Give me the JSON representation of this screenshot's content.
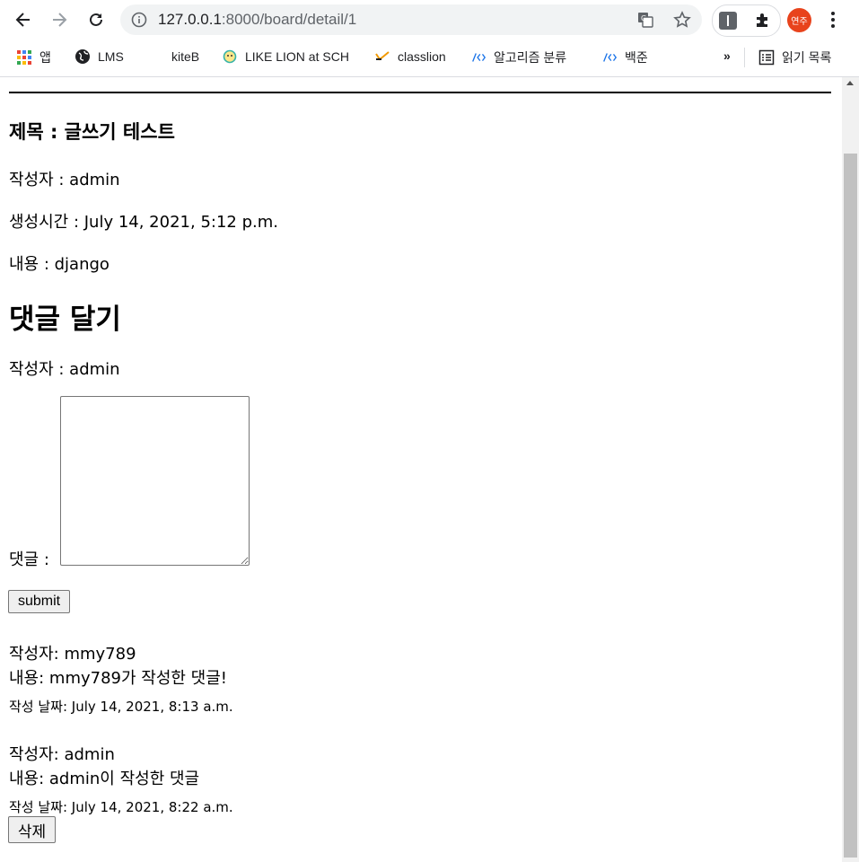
{
  "browser": {
    "url_host": "127.0.0.1",
    "url_rest": ":8000/board/detail/1",
    "profile_initials": "연주",
    "bookmarks": [
      {
        "label": "앱",
        "icon": "apps-grid-icon"
      },
      {
        "label": "LMS",
        "icon": "globe-icon"
      },
      {
        "label": "kiteB",
        "icon": "blank-icon"
      },
      {
        "label": "LIKE LION at SCH",
        "icon": "lion-icon"
      },
      {
        "label": "classlion",
        "icon": "classlion-icon"
      },
      {
        "label": "알고리즘 분류",
        "icon": "code-icon"
      },
      {
        "label": "백준",
        "icon": "code-icon"
      }
    ],
    "more_label": "»",
    "reading_list_label": "읽기 목록"
  },
  "post": {
    "title": "제목 : 글쓰기 테스트",
    "author": "작성자 : admin",
    "created": "생성시간 : July 14, 2021, 5:12 p.m.",
    "content": "내용 : django"
  },
  "comment_form": {
    "heading": "댓글 달기",
    "author": "작성자 : admin",
    "comment_label": "댓글 :",
    "submit_label": "submit"
  },
  "comments": [
    {
      "author": "작성자: mmy789",
      "content": "내용: mmy789가 작성한 댓글!",
      "date": "작성 날짜: July 14, 2021, 8:13 a.m."
    },
    {
      "author": "작성자: admin",
      "content": "내용: admin이 작성한 댓글",
      "date": "작성 날짜: July 14, 2021, 8:22 a.m.",
      "delete_label": "삭제"
    }
  ]
}
